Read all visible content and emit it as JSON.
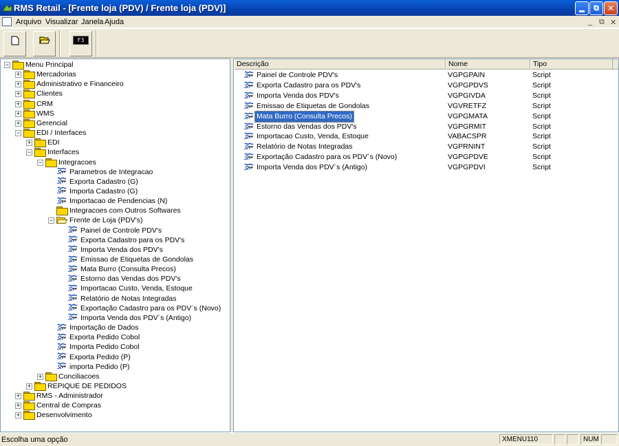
{
  "window": {
    "title": "RMS Retail - [Frente loja (PDV) / Frente loja (PDV)]"
  },
  "menu": {
    "items": [
      {
        "label": "Arquivo"
      },
      {
        "label": "Visualizar"
      },
      {
        "label": "Janela"
      },
      {
        "label": "Ajuda"
      }
    ]
  },
  "toolbar": {
    "f3_label": "F3"
  },
  "tree": {
    "root": "Menu Principal",
    "nodes": [
      {
        "label": "Mercadorias"
      },
      {
        "label": "Administrativo e Financeiro"
      },
      {
        "label": "Clientes"
      },
      {
        "label": "CRM"
      },
      {
        "label": "WMS"
      },
      {
        "label": "Gerencial"
      },
      {
        "label": "EDI / Interfaces"
      },
      {
        "label": "EDI"
      },
      {
        "label": "Interfaces"
      },
      {
        "label": "Integracoes"
      },
      {
        "label": "Parametros de Integracao"
      },
      {
        "label": "Exporta Cadastro (G)"
      },
      {
        "label": "Importa Cadastro (G)"
      },
      {
        "label": "Importacao de Pendencias (N)"
      },
      {
        "label": "Integracoes com Outros Softwares"
      },
      {
        "label": "Frente de Loja (PDV's)"
      },
      {
        "label": "Painel de Controle PDV's"
      },
      {
        "label": "Exporta Cadastro para os PDV's"
      },
      {
        "label": "Importa Venda dos PDV's"
      },
      {
        "label": "Emissao de Etiquetas de Gondolas"
      },
      {
        "label": "Mata Burro (Consulta Precos)"
      },
      {
        "label": "Estorno das Vendas dos PDV's"
      },
      {
        "label": "Importacao Custo, Venda, Estoque"
      },
      {
        "label": "Relatório de Notas Integradas"
      },
      {
        "label": "Exportação Cadastro para os PDV´s (Novo)"
      },
      {
        "label": "Importa Venda dos PDV´s (Antigo)"
      },
      {
        "label": "Importação de Dados"
      },
      {
        "label": "Exporta Pedido Cobol"
      },
      {
        "label": "Importa Pedido Cobol"
      },
      {
        "label": "Exporta Pedido (P)"
      },
      {
        "label": "importa Pedido (P)"
      },
      {
        "label": "Conciliacoes"
      },
      {
        "label": "REPIQUE DE PEDIDOS"
      },
      {
        "label": "RMS - Administrador"
      },
      {
        "label": "Central de Compras"
      },
      {
        "label": "Desenvolvimento"
      }
    ]
  },
  "list": {
    "columns": [
      "Descrição",
      "Nome",
      "Tipo"
    ],
    "rows": [
      {
        "desc": "Painel de Controle PDV's",
        "name": "VGPGPAIN",
        "type": "Script"
      },
      {
        "desc": "Exporta Cadastro para os PDV's",
        "name": "VGPGPDVS",
        "type": "Script"
      },
      {
        "desc": "Importa Venda dos PDV's",
        "name": "VGPGIVDA",
        "type": "Script"
      },
      {
        "desc": "Emissao de Etiquetas de Gondolas",
        "name": "VGVRETFZ",
        "type": "Script"
      },
      {
        "desc": "Mata Burro (Consulta Precos)",
        "name": "VGPGMATA",
        "type": "Script"
      },
      {
        "desc": "Estorno das Vendas dos PDV's",
        "name": "VGPGRMIT",
        "type": "Script"
      },
      {
        "desc": "Importacao Custo, Venda, Estoque",
        "name": "VABACSPR",
        "type": "Script"
      },
      {
        "desc": "Relatório de Notas Integradas",
        "name": "VGPRNINT",
        "type": "Script"
      },
      {
        "desc": "Exportação Cadastro para os PDV´s (Novo)",
        "name": "VGPGPDVE",
        "type": "Script"
      },
      {
        "desc": "Importa Venda dos PDV´s (Antigo)",
        "name": "VGPGPDVI",
        "type": "Script"
      }
    ]
  },
  "status": {
    "text": "Escolha uma opção",
    "module": "XMENU110",
    "num": "NUM"
  }
}
